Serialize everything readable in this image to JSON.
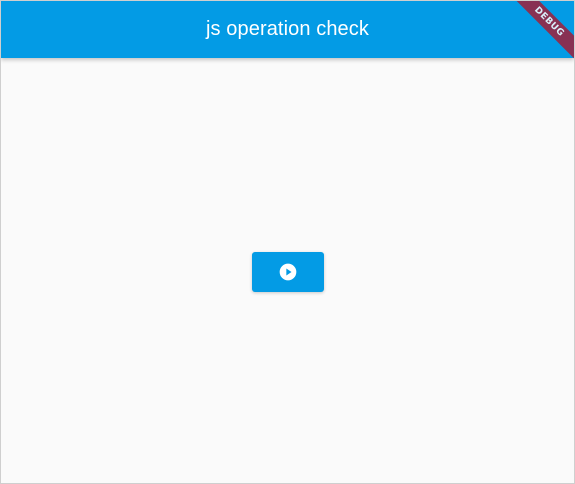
{
  "app_bar": {
    "title": "js operation check",
    "color": "#039be5"
  },
  "main": {
    "run_button": {
      "icon": "play-circle-icon",
      "color": "#039be5"
    }
  },
  "debug_banner": {
    "label": "DEBUG",
    "color": "#a01f3a"
  }
}
